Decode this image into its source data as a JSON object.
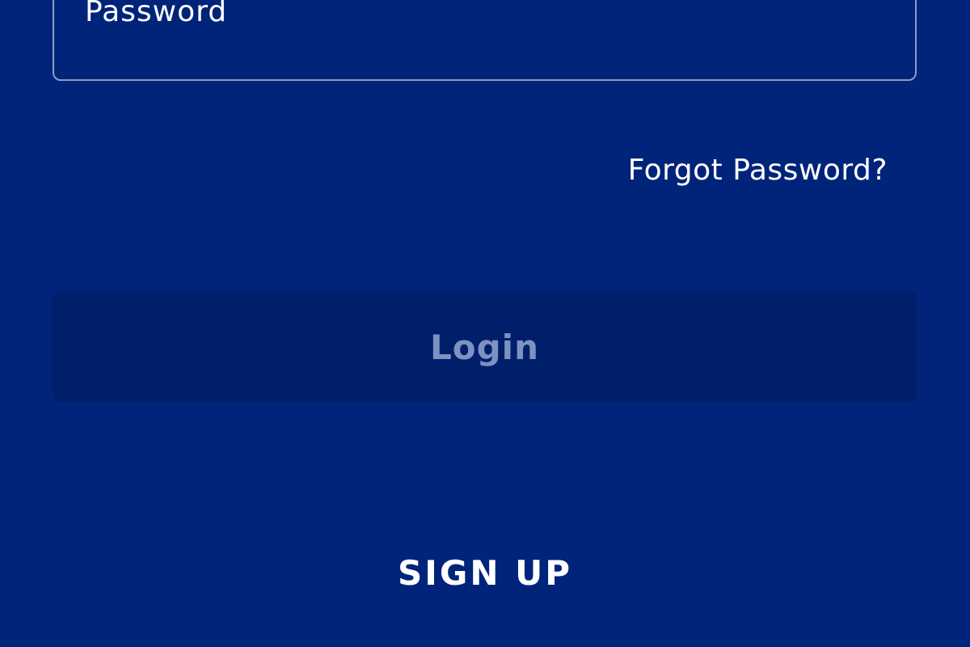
{
  "colors": {
    "background": "#00247a",
    "login_button_bg": "#001f6a",
    "login_button_text": "#7e92c2",
    "text": "#ffffff"
  },
  "password": {
    "label": "Password"
  },
  "forgot_password": {
    "label": "Forgot Password?"
  },
  "login_button": {
    "label": "Login",
    "state": "disabled"
  },
  "signup": {
    "label": "SIGN UP"
  }
}
